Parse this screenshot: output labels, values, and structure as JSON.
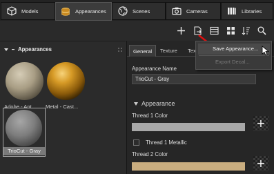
{
  "tabs": [
    {
      "label": "Models",
      "icon": "cube-icon"
    },
    {
      "label": "Appearances",
      "icon": "paint-can-icon",
      "active": true
    },
    {
      "label": "Scenes",
      "icon": "globe-icon"
    },
    {
      "label": "Cameras",
      "icon": "camera-icon"
    },
    {
      "label": "Libraries",
      "icon": "books-icon"
    }
  ],
  "toolbar": [
    "add-icon",
    "export-icon",
    "panel-icon",
    "grid-icon",
    "sort-icon",
    "search-icon"
  ],
  "left_panel": {
    "header": "Appearances",
    "materials": [
      {
        "name": "Adobe - Ant...",
        "kind": "matte-beige"
      },
      {
        "name": "Metal - Cast...",
        "kind": "gold"
      },
      {
        "name": "TrioCut - Gray",
        "kind": "gray",
        "selected": true
      }
    ]
  },
  "right_panel": {
    "tabs": [
      "General",
      "Texture",
      "Tex"
    ],
    "name_label": "Appearance Name",
    "name_value": "TrioCut - Gray",
    "section": "Appearance",
    "thread1_label": "Thread 1 Color",
    "thread1_color": "#a8a8a8",
    "metallic_label": "Thread 1 Metallic",
    "thread2_label": "Thread 2 Color",
    "thread2_color": "#c9ad7f",
    "plus": "+"
  },
  "menu": {
    "items": [
      "Save Appearance...",
      "Export Decal..."
    ],
    "disabled": [
      false,
      true
    ]
  },
  "colors": {
    "accent_arrow": "#e01010",
    "selection": "#7a7a7a"
  }
}
